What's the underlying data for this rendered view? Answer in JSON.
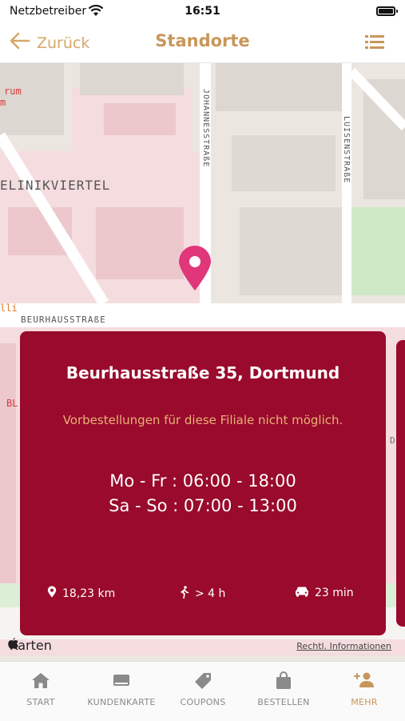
{
  "status_bar": {
    "carrier": "Netzbetreiber",
    "time": "16:51"
  },
  "header": {
    "back_label": "Zurück",
    "title": "Standorte"
  },
  "map": {
    "labels": {
      "district": "ELINIKVIERTEL",
      "street_1": "BEURHAUSSTRAßE",
      "street_2": "JOHANNESSTRAßE",
      "street_3": "LUISENSTRAßE",
      "poi_1": "rum",
      "poi_2": "m",
      "poi_3": "lli",
      "poi_4": "BL",
      "poi_5": "D"
    },
    "brand": "Karten",
    "legal": "Rechtl. Informationen"
  },
  "store_card": {
    "address": "Beurhausstraße 35, Dortmund",
    "notice": "Vorbestellungen für diese Filiale nicht möglich.",
    "hours": [
      "Mo - Fr : 06:00 - 18:00",
      "Sa - So : 07:00 - 13:00"
    ],
    "distance": "18,23 km",
    "walk_time": "> 4 h",
    "drive_time": "23 min"
  },
  "tabs": [
    {
      "label": "START"
    },
    {
      "label": "KUNDENKARTE"
    },
    {
      "label": "COUPONS"
    },
    {
      "label": "BESTELLEN"
    },
    {
      "label": "MEHR"
    }
  ],
  "colors": {
    "accent": "#c8965a",
    "card": "#990a2c",
    "notice": "#e9b277",
    "pin": "#e0367a"
  }
}
